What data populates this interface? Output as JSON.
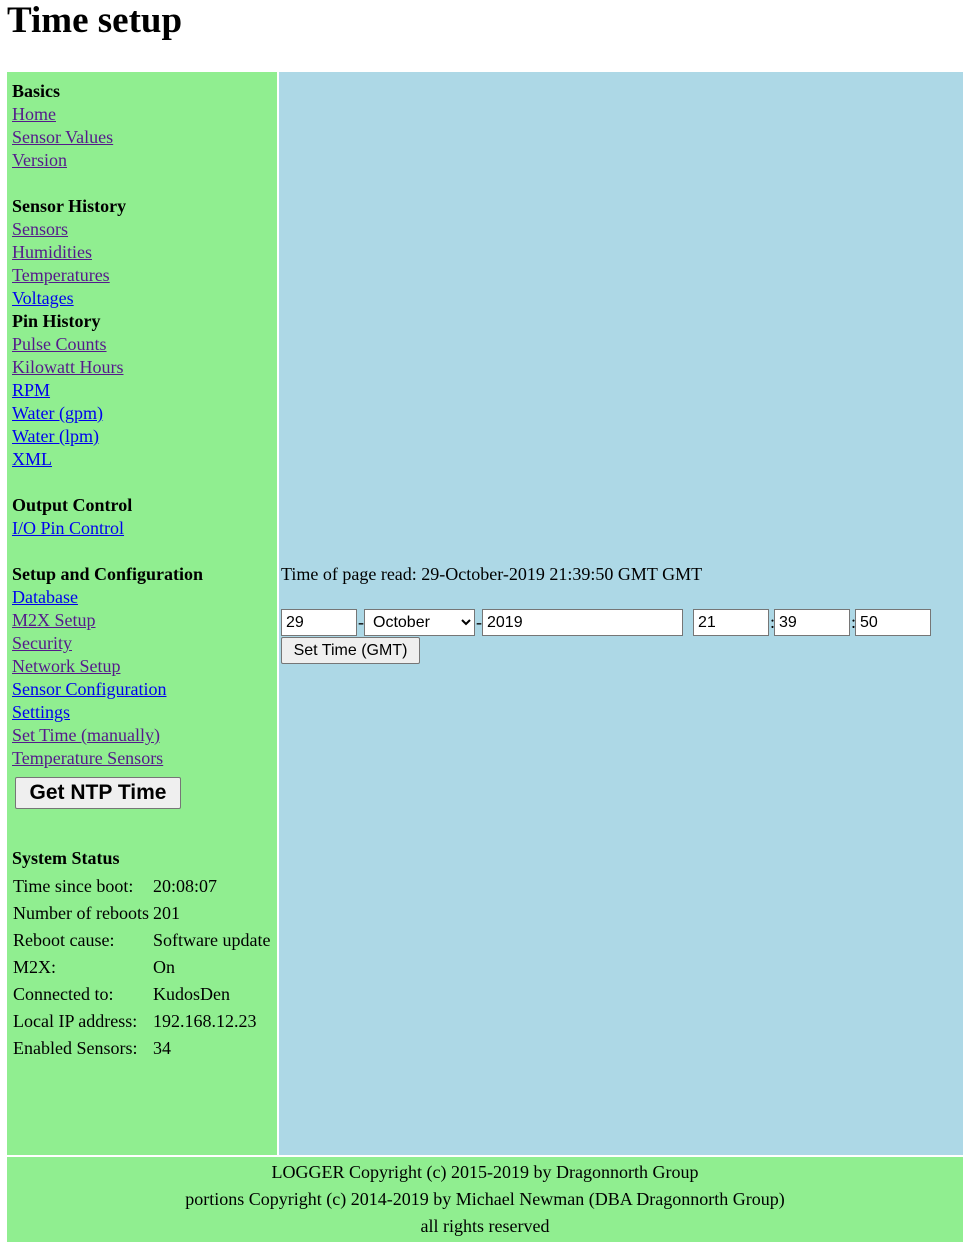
{
  "page_title": "Time setup",
  "nav": {
    "basics": {
      "header": "Basics",
      "links": [
        "Home",
        "Sensor Values",
        "Version"
      ]
    },
    "sensor_history": {
      "header": "Sensor History",
      "links": [
        "Sensors",
        "Humidities",
        "Temperatures",
        "Voltages"
      ]
    },
    "pin_history": {
      "header": "Pin History",
      "links": [
        "Pulse Counts",
        "Kilowatt Hours",
        "RPM",
        "Water (gpm)",
        "Water (lpm)",
        "XML"
      ]
    },
    "output_control": {
      "header": "Output Control",
      "links": [
        "I/O Pin Control"
      ]
    },
    "setup": {
      "header": "Setup and Configuration",
      "links": [
        "Database",
        "M2X Setup",
        "Security",
        "Network Setup",
        "Sensor Configuration",
        "Settings",
        "Set Time (manually)",
        "Temperature Sensors"
      ]
    },
    "ntp_button": "Get NTP Time"
  },
  "status": {
    "title": "System Status",
    "rows": [
      {
        "label": "Time since boot:",
        "value": "20:08:07"
      },
      {
        "label": "Number of reboots",
        "value": "201"
      },
      {
        "label": "Reboot cause:",
        "value": "Software update"
      },
      {
        "label": "M2X:",
        "value": "On"
      },
      {
        "label": "Connected to:",
        "value": "KudosDen"
      },
      {
        "label": "Local IP address:",
        "value": "192.168.12.23"
      },
      {
        "label": "Enabled Sensors:",
        "value": "34"
      }
    ]
  },
  "time_form": {
    "read_label": "Time of page read: 29-October-2019 21:39:50 GMT GMT",
    "day": "29",
    "month": "October",
    "year": "2019",
    "hour": "21",
    "minute": "39",
    "second": "50",
    "date_sep": "-",
    "time_sep": ":",
    "submit": "Set Time (GMT)"
  },
  "footer": {
    "line1": "LOGGER Copyright (c) 2015-2019 by Dragonnorth Group",
    "line2": "portions Copyright (c) 2014-2019 by Michael Newman (DBA Dragonnorth Group)",
    "line3": "all rights reserved"
  },
  "colors": {
    "sidebar_bg": "#90ee90",
    "content_bg": "#add8e6",
    "link_visited": "#551a8b",
    "link_unvisited": "#0000ee"
  }
}
